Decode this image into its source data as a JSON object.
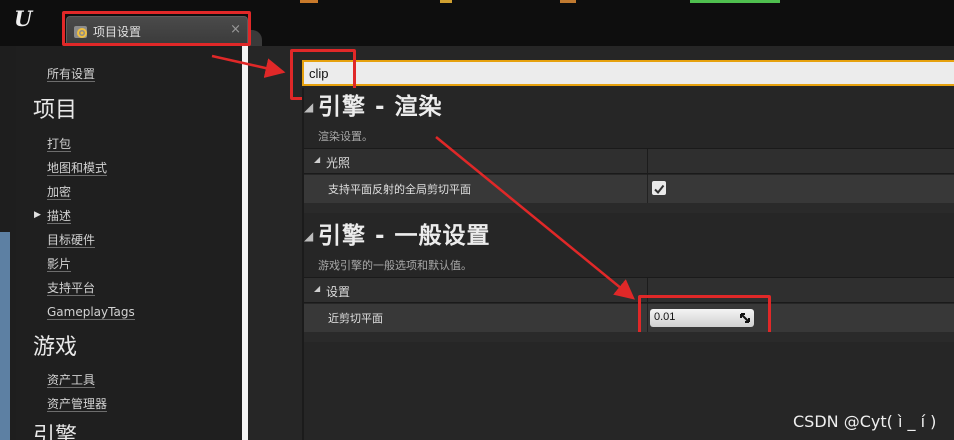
{
  "app": {
    "tab_title": "项目设置",
    "tab_close": "×",
    "logo_text": "U"
  },
  "sidebar": {
    "all_settings": "所有设置",
    "sections": [
      {
        "heading": "项目",
        "items": [
          "打包",
          "地图和模式",
          "加密",
          "描述",
          "目标硬件",
          "影片",
          "支持平台",
          "GameplayTags"
        ]
      },
      {
        "heading": "游戏",
        "items": [
          "资产工具",
          "资产管理器"
        ]
      },
      {
        "heading": "引擎",
        "items": []
      }
    ],
    "bullet_marker": "▶"
  },
  "search": {
    "value": "clip"
  },
  "sections": [
    {
      "title": "引擎 - 渲染",
      "description": "渲染设置。",
      "category": "光照",
      "property": {
        "label": "支持平面反射的全局剪切平面",
        "type": "checkbox",
        "checked": true
      }
    },
    {
      "title": "引擎 - 一般设置",
      "description": "游戏引擎的一般选项和默认值。",
      "category": "设置",
      "property": {
        "label": "近剪切平面",
        "type": "number",
        "value": "0.01"
      }
    }
  ],
  "watermark": "CSDN @Cyt( ì _ í )",
  "colors": {
    "annotation": "#e02828",
    "search_focus": "#e6a10e",
    "panel_bg": "#262626",
    "row_bg": "#383838"
  },
  "icons": {
    "tab": "settings-gear-icon",
    "category_expander": "triangle-down-icon",
    "section_expander": "triangle-down-icon",
    "number_drag": "drag-handle-icon"
  }
}
